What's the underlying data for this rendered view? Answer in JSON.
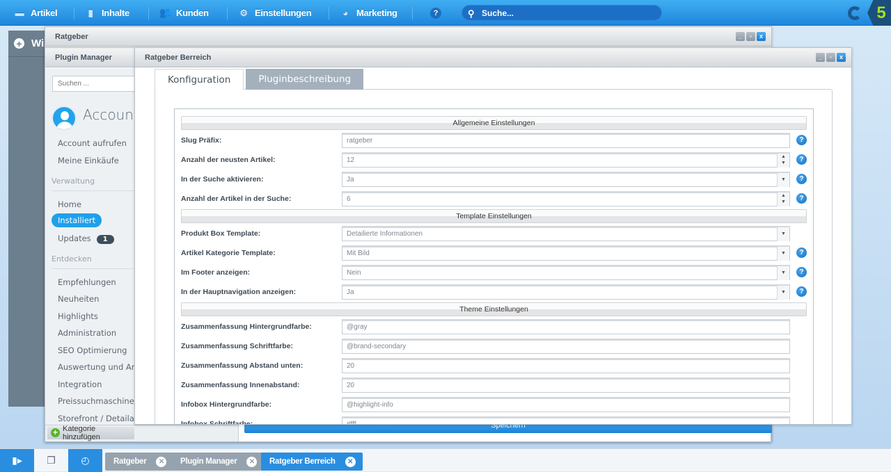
{
  "topnav": {
    "items": [
      {
        "label": "Artikel",
        "icon": "inbox-icon"
      },
      {
        "label": "Inhalte",
        "icon": "document-icon"
      },
      {
        "label": "Kunden",
        "icon": "users-icon"
      },
      {
        "label": "Einstellungen",
        "icon": "gear-icon"
      },
      {
        "label": "Marketing",
        "icon": "pie-chart-icon"
      }
    ],
    "help_icon": "?",
    "search_placeholder": "Suche...",
    "logo_text": "5"
  },
  "widgets": {
    "title": "Wi"
  },
  "windows": {
    "ratgeber": "Ratgeber",
    "plugin_manager": "Plugin Manager",
    "ratgeber_bereich": "Ratgeber Berreich"
  },
  "plugin_manager": {
    "search_placeholder": "Suchen ...",
    "account_title": "Account",
    "account_items": [
      "Account aufrufen",
      "Meine Einkäufe"
    ],
    "verwaltung_header": "Verwaltung",
    "verwaltung_items": [
      "Home",
      "Installiert",
      "Updates"
    ],
    "updates_badge": "1",
    "entdecken_header": "Entdecken",
    "entdecken_items": [
      "Empfehlungen",
      "Neuheiten",
      "Highlights",
      "Administration",
      "SEO Optimierung",
      "Auswertung und Analyse",
      "Integration",
      "Preissuchmaschinen / ",
      "Storefront / Detailanpassungen"
    ],
    "add_category": "Kategorie hinzufügen",
    "save": "Speichern"
  },
  "tabs": [
    "Konfiguration",
    "Pluginbeschreibung"
  ],
  "form": [
    {
      "section": "Allgemeine Einstellungen",
      "rows": [
        {
          "label": "Slug Präfix:",
          "value": "ratgeber",
          "type": "text",
          "help": true
        },
        {
          "label": "Anzahl der neusten Artikel:",
          "value": "12",
          "type": "number",
          "help": true
        },
        {
          "label": "In der Suche aktivieren:",
          "value": "Ja",
          "type": "select",
          "help": true
        },
        {
          "label": "Anzahl der Artikel in der Suche:",
          "value": "6",
          "type": "number",
          "help": true
        }
      ]
    },
    {
      "section": "Template Einstellungen",
      "rows": [
        {
          "label": "Produkt Box Template:",
          "value": "Detailierte Informationen",
          "type": "select",
          "help": false
        },
        {
          "label": "Artikel Kategorie Template:",
          "value": "Mit Bild",
          "type": "select",
          "help": true
        },
        {
          "label": "Im Footer anzeigen:",
          "value": "Nein",
          "type": "select",
          "help": true
        },
        {
          "label": "In der Hauptnavigation anzeigen:",
          "value": "Ja",
          "type": "select",
          "help": true
        }
      ]
    },
    {
      "section": "Theme Einstellungen",
      "rows": [
        {
          "label": "Zusammenfassung Hintergrundfarbe:",
          "value": "@gray",
          "type": "text",
          "help": false
        },
        {
          "label": "Zusammenfassung Schriftfarbe:",
          "value": "@brand-secondary",
          "type": "text",
          "help": false
        },
        {
          "label": "Zusammenfassung Abstand unten:",
          "value": "20",
          "type": "text",
          "help": false
        },
        {
          "label": "Zusammenfassung Innenabstand:",
          "value": "20",
          "type": "text",
          "help": false
        },
        {
          "label": "Infobox Hintergrundfarbe:",
          "value": "@highlight-info",
          "type": "text",
          "help": false
        },
        {
          "label": "Infobox Schriftfarbe:",
          "value": "#fff",
          "type": "text",
          "help": false
        }
      ]
    }
  ],
  "taskbar": {
    "tabs": [
      {
        "label": "Ratgeber",
        "active": false
      },
      {
        "label": "Plugin Manager",
        "active": false
      },
      {
        "label": "Ratgeber Berreich",
        "active": true
      }
    ]
  },
  "colors": {
    "accent": "#1f86dc",
    "inactive_tab": "#a4b1bd",
    "brand_green": "#a5e020"
  }
}
